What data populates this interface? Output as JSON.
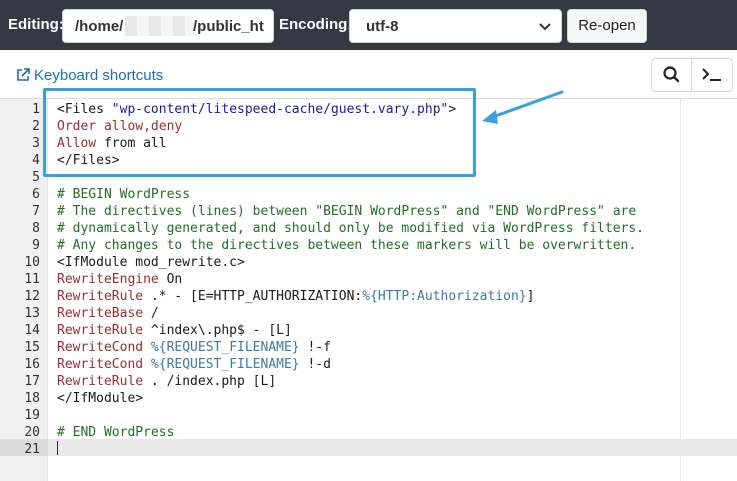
{
  "toolbar": {
    "editing_label": "Editing:",
    "path_start": "/home/",
    "path_end": "/public_ht",
    "encoding_label": "Encoding:",
    "encoding_value": "utf-8",
    "reopen_label": "Re-open"
  },
  "subbar": {
    "keyboard_shortcuts_label": "Keyboard shortcuts",
    "search_icon": "search-icon",
    "terminal_icon": "terminal-icon"
  },
  "colors": {
    "toolbar_bg": "#333a44",
    "link": "#1a6fb5",
    "highlight_box": "#3a9fe0",
    "comment": "#236e25",
    "keyword": "#9b2e2e",
    "string": "#1a1aa6"
  },
  "editor": {
    "lines": [
      {
        "n": "1",
        "text": "<Files \"wp-content/litespeed-cache/guest.vary.php\">"
      },
      {
        "n": "2",
        "text": "Order allow,deny"
      },
      {
        "n": "3",
        "text": "Allow from all"
      },
      {
        "n": "4",
        "text": "</Files>"
      },
      {
        "n": "5",
        "text": ""
      },
      {
        "n": "6",
        "text": "# BEGIN WordPress"
      },
      {
        "n": "7",
        "text": "# The directives (lines) between \"BEGIN WordPress\" and \"END WordPress\" are"
      },
      {
        "n": "8",
        "text": "# dynamically generated, and should only be modified via WordPress filters."
      },
      {
        "n": "9",
        "text": "# Any changes to the directives between these markers will be overwritten."
      },
      {
        "n": "10",
        "text": "<IfModule mod_rewrite.c>"
      },
      {
        "n": "11",
        "text": "RewriteEngine On"
      },
      {
        "n": "12",
        "text": "RewriteRule .* - [E=HTTP_AUTHORIZATION:%{HTTP:Authorization}]"
      },
      {
        "n": "13",
        "text": "RewriteBase /"
      },
      {
        "n": "14",
        "text": "RewriteRule ^index\\.php$ - [L]"
      },
      {
        "n": "15",
        "text": "RewriteCond %{REQUEST_FILENAME} !-f"
      },
      {
        "n": "16",
        "text": "RewriteCond %{REQUEST_FILENAME} !-d"
      },
      {
        "n": "17",
        "text": "RewriteRule . /index.php [L]"
      },
      {
        "n": "18",
        "text": "</IfModule>"
      },
      {
        "n": "19",
        "text": ""
      },
      {
        "n": "20",
        "text": "# END WordPress"
      },
      {
        "n": "21",
        "text": ""
      }
    ]
  }
}
